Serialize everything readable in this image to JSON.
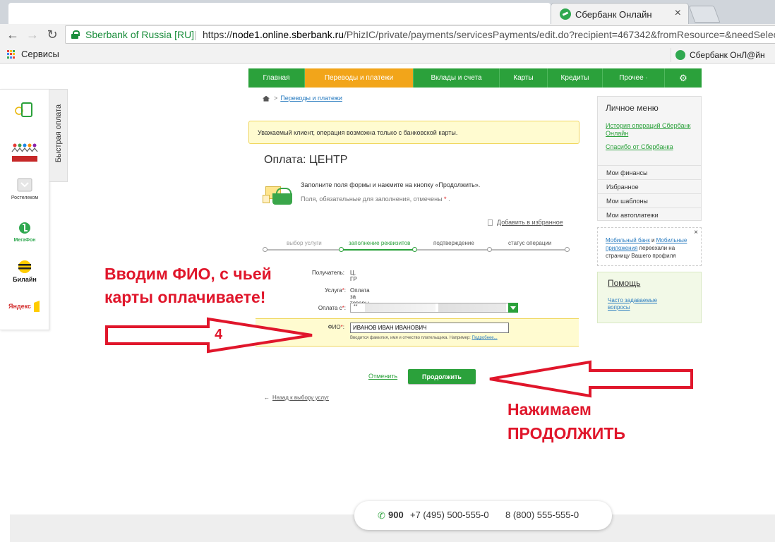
{
  "browser": {
    "tab_title": "Сбербанк Онлайн",
    "tab_close": "×",
    "site_identity": "Sberbank of Russia [RU]",
    "separator": "|",
    "url_scheme": "https://",
    "url_host": "node1.online.sberbank.ru",
    "url_path": "/PhizIC/private/payments/servicesPayments/edit.do?recipient=467342&fromResource=&needSelec",
    "bookmark_services": "Сервисы",
    "bookmark_right": "Сбербанк ОнЛ@йн",
    "apps_colors": [
      "#ea4335",
      "#fbbc05",
      "#34a853",
      "#4285f4",
      "#ea4335",
      "#fbbc05",
      "#34a853",
      "#4285f4",
      "#ea4335"
    ]
  },
  "quick_pay": {
    "tab_label": "Быстрая оплата",
    "items": [
      {
        "name": "phone-top-up-icon",
        "label": ""
      },
      {
        "name": "charity-icon",
        "label": ""
      },
      {
        "name": "rostelecom-icon",
        "label": "Ростелеком"
      },
      {
        "name": "megafon-icon",
        "label": "МегаФон"
      },
      {
        "name": "beeline-icon",
        "label": "Билайн"
      },
      {
        "name": "yandex-icon",
        "label": "Яндекс"
      }
    ]
  },
  "topnav": {
    "items": [
      {
        "label": "Главная",
        "active": false
      },
      {
        "label": "Переводы и платежи",
        "active": true
      },
      {
        "label": "Вклады и счета",
        "active": false
      },
      {
        "label": "Карты",
        "active": false
      },
      {
        "label": "Кредиты",
        "active": false
      },
      {
        "label": "Прочее ·",
        "active": false
      }
    ],
    "settings_icon": "⚙"
  },
  "breadcrumb": {
    "arrow": ">",
    "link": "Переводы и платежи"
  },
  "notice": "Уважаемый клиент, операция возможна только с банковской карты.",
  "page_title": "Оплата: ЦЕНТР",
  "instructions": {
    "line1": "Заполните поля формы и нажмите на кнопку «Продолжить».",
    "line2": "Поля, обязательные для заполнения, отмечены",
    "required_mark": "*",
    "line2_end": "."
  },
  "favorites": "Добавить в избранное",
  "steps": [
    {
      "label": "выбор услуги",
      "state": "done"
    },
    {
      "label": "заполнение реквизитов",
      "state": "active"
    },
    {
      "label": "подтверждение",
      "state": "todo"
    },
    {
      "label": "статус операции",
      "state": "todo"
    }
  ],
  "form": {
    "recipient_label": "Получатель:",
    "recipient_value": "Ц.  ГР",
    "service_label": "Услуга",
    "service_value": "Оплата за товары",
    "payment_label": "Оплата с",
    "payment_value": "**",
    "fio_label": "ФИО",
    "fio_value": "ИВАНОВ ИВАН ИВАНОВИЧ",
    "fio_hint": "Вводится фамилия, имя и отчество плательщика. Например:",
    "fio_hint_link": "Подробнее...",
    "required_mark": "*",
    "colon": ":"
  },
  "actions": {
    "cancel": "Отменить",
    "continue": "Продолжить",
    "back": "Назад к выбору услуг",
    "back_arrow": "←"
  },
  "sidebar": {
    "title": "Личное меню",
    "link1": "История операций Сбербанк Онлайн",
    "link2": "Спасибо от Сбербанка",
    "items": [
      "Мои финансы",
      "Избранное",
      "Мои шаблоны",
      "Мои автоплатежи"
    ],
    "mobile": {
      "close": "×",
      "text_link1": "Мобильный банк",
      "text_mid": " и ",
      "text_link2": "Мобильные приложения",
      "text_rest": " переехали на страницу Вашего профиля"
    },
    "help_title": "Помощь",
    "help_link": "Часто задаваемые вопросы"
  },
  "annotations": {
    "fio_note_line1": "Вводим ФИО, с чьей",
    "fio_note_line2": "карты оплачиваете!",
    "step_number": "4",
    "continue_note_line1": "Нажимаем",
    "continue_note_line2": "ПРОДОЛЖИТЬ",
    "color": "#e0162b"
  },
  "footer": {
    "phone_icon": "✆",
    "short": "900",
    "phone1": "+7 (495) 500-555-0",
    "phone2": "8 (800) 555-555-0"
  },
  "colors": {
    "sber_green": "#2ba13b",
    "active_orange": "#f2a51a",
    "notice_bg": "#fffbd0"
  }
}
